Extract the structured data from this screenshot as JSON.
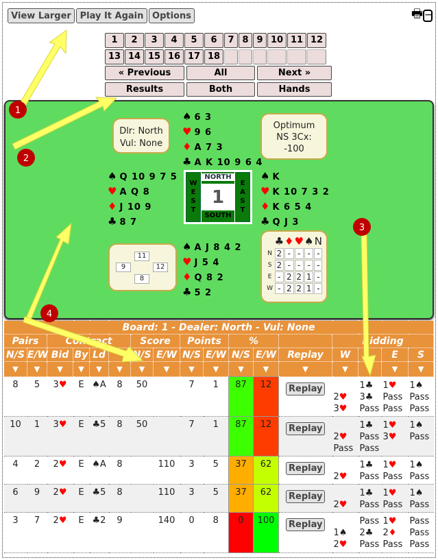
{
  "toolbar": {
    "view_larger": "View Larger",
    "play_again": "Play It Again",
    "options": "Options",
    "print_icon": "printer-icon",
    "minimize_icon": "minus-box-icon"
  },
  "boards": {
    "row1": [
      "1",
      "2",
      "3",
      "4",
      "5",
      "6",
      "7",
      "8",
      "9",
      "10",
      "11",
      "12"
    ],
    "row2": [
      "13",
      "14",
      "15",
      "16",
      "17",
      "18",
      "",
      "",
      "",
      "",
      "",
      ""
    ]
  },
  "nav": {
    "previous": "«  Previous",
    "all": "All",
    "next": "Next  »",
    "results": "Results",
    "both": "Both",
    "hands": "Hands"
  },
  "deal": {
    "dealer_label": "Dlr: North",
    "vul_label": "Vul: None",
    "optimum": [
      "Optimum",
      "NS 3Cx:",
      "-100"
    ],
    "north": {
      "spades": "6 3",
      "hearts": "9 6",
      "diamonds": "A 7 3",
      "clubs": "A K 10 9 6 4"
    },
    "west": {
      "spades": "Q 10 9 7 5",
      "hearts": "A Q 8",
      "diamonds": "J 10 9",
      "clubs": "8 7"
    },
    "east": {
      "spades": "K",
      "hearts": "K 10 7 3 2",
      "diamonds": "K 6 5 4",
      "clubs": "Q J 3"
    },
    "south": {
      "spades": "A J 8 4 2",
      "hearts": "J 5 4",
      "diamonds": "Q 8 2",
      "clubs": "5 2"
    },
    "compass": {
      "north": "NORTH",
      "south": "SOUTH",
      "west": "W E S T",
      "east": "E A S T",
      "board": "1"
    },
    "hcp": {
      "north": "11",
      "west": "9",
      "east": "12",
      "south": "8"
    },
    "par": {
      "suits": [
        "♣",
        "♦",
        "♥",
        "♠",
        "N"
      ],
      "rows": [
        [
          "N",
          "2",
          "-",
          "-",
          "-",
          "-"
        ],
        [
          "S",
          "2",
          "-",
          "-",
          "-",
          "-"
        ],
        [
          "E",
          "-",
          "2",
          "2",
          "1",
          "-"
        ],
        [
          "W",
          "-",
          "2",
          "2",
          "1",
          "-"
        ]
      ]
    }
  },
  "results": {
    "title": "Board: 1 - Dealer: North - Vul: None",
    "groups": [
      "Pairs",
      "Contract",
      "Score",
      "Points",
      "%",
      "",
      "Bidding"
    ],
    "columns": [
      "N/S",
      "E/W",
      "Bid",
      "By",
      "Ld",
      "",
      "N/S",
      "E/W",
      "N/S",
      "E/W",
      "N/S",
      "E/W",
      "Replay",
      "W",
      "",
      "E",
      "S"
    ],
    "replay_label": "Replay",
    "rows": [
      {
        "cells": [
          "8",
          "5",
          "3♥",
          "E",
          "♠A",
          "8",
          "50",
          "",
          "7",
          "1"
        ],
        "pct": [
          "87",
          "12"
        ],
        "pct_colors": [
          "#3cff00",
          "#ff3c00"
        ],
        "bidding": [
          [
            "",
            "2♥",
            "3♥"
          ],
          [
            "1♣",
            "3♣",
            "Pass"
          ],
          [
            "1♥",
            "Pass",
            "Pass"
          ],
          [
            "1♠",
            "Pass",
            "Pass"
          ]
        ]
      },
      {
        "cells": [
          "10",
          "1",
          "3♥",
          "E",
          "♣5",
          "8",
          "50",
          "",
          "7",
          "1"
        ],
        "pct": [
          "87",
          "12"
        ],
        "pct_colors": [
          "#3cff00",
          "#ff3c00"
        ],
        "bidding": [
          [
            "",
            "2♥",
            "Pass"
          ],
          [
            "1♣",
            "Pass",
            "Pass"
          ],
          [
            "1♥",
            "3♥",
            ""
          ],
          [
            "1♠",
            "Pass",
            ""
          ]
        ]
      },
      {
        "cells": [
          "4",
          "2",
          "2♥",
          "E",
          "♠A",
          "8",
          "",
          "110",
          "3",
          "5"
        ],
        "pct": [
          "37",
          "62"
        ],
        "pct_colors": [
          "#ffae00",
          "#c3ff00"
        ],
        "bidding": [
          [
            "",
            "2♥"
          ],
          [
            "1♣",
            "Pass"
          ],
          [
            "1♥",
            "Pass"
          ],
          [
            "1♠",
            "Pass"
          ]
        ]
      },
      {
        "cells": [
          "6",
          "9",
          "2♥",
          "E",
          "♣5",
          "8",
          "",
          "110",
          "3",
          "5"
        ],
        "pct": [
          "37",
          "62"
        ],
        "pct_colors": [
          "#ffae00",
          "#c3ff00"
        ],
        "bidding": [
          [
            "",
            "2♥"
          ],
          [
            "1♣",
            "Pass"
          ],
          [
            "1♥",
            "Pass"
          ],
          [
            "1♠",
            "Pass"
          ]
        ]
      },
      {
        "cells": [
          "3",
          "7",
          "2♥",
          "E",
          "♣2",
          "9",
          "",
          "140",
          "0",
          "8"
        ],
        "pct": [
          "0",
          "100"
        ],
        "pct_colors": [
          "#ff0000",
          "#00ff00"
        ],
        "bidding": [
          [
            "",
            "1♠",
            "2♥"
          ],
          [
            "Pass",
            "2♣",
            "Pass"
          ],
          [
            "1♥",
            "2♦",
            "Pass"
          ],
          [
            "Pass",
            "Pass",
            "Pass"
          ]
        ]
      }
    ]
  },
  "annotations": {
    "markers": [
      "1",
      "2",
      "3",
      "4"
    ],
    "arrow_color": "#ffff66",
    "marker_color": "#c00000"
  }
}
